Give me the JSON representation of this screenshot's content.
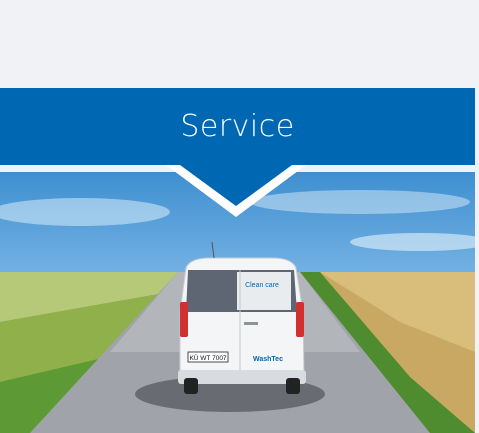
{
  "header": {
    "title": "Service",
    "color": "#0067b3"
  },
  "photo": {
    "van": {
      "window_decal": "Clean care",
      "plate": "KÜ WT 7007",
      "brand": "WashTec"
    }
  }
}
